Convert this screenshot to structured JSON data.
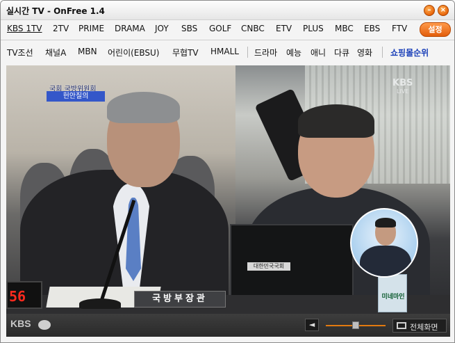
{
  "window": {
    "title": "실시간 TV - OnFree 1.4",
    "min_icon": "minimize-icon",
    "close_icon": "close-icon"
  },
  "channels_row1": [
    {
      "label": "KBS 1TV",
      "active": true
    },
    {
      "label": "2TV"
    },
    {
      "label": "PRIME"
    },
    {
      "label": "DRAMA"
    },
    {
      "label": "JOY"
    },
    {
      "label": "SBS"
    },
    {
      "label": "GOLF"
    },
    {
      "label": "CNBC"
    },
    {
      "label": "ETV"
    },
    {
      "label": "PLUS"
    },
    {
      "label": "MBC"
    },
    {
      "label": "EBS"
    },
    {
      "label": "FTV"
    }
  ],
  "settings_label": "설정",
  "channels_row2": [
    {
      "label": "TV조선"
    },
    {
      "label": "채널A"
    },
    {
      "label": "MBN"
    },
    {
      "label": "어린이(EBSU)"
    },
    {
      "label": "무협TV"
    },
    {
      "label": "HMALL"
    },
    {
      "label": "드라마"
    },
    {
      "label": "예능"
    },
    {
      "label": "애니"
    },
    {
      "label": "다큐"
    },
    {
      "label": "영화"
    },
    {
      "label": "쇼핑몰순위",
      "highlight": true
    }
  ],
  "video": {
    "caption_small": "국회 국방위원회",
    "caption_bar": "헌안질의",
    "watermark_top": "KBS",
    "watermark_sub": "LIVE",
    "nameplate": "국방부장관",
    "led_number": "56",
    "laptop_label": "대한민국국회",
    "bottle_label": "미네마인"
  },
  "controls": {
    "brand": "KBS",
    "volume_icon": "speaker-icon",
    "volume_level": 0.5,
    "fullscreen_label": "전체화면"
  }
}
